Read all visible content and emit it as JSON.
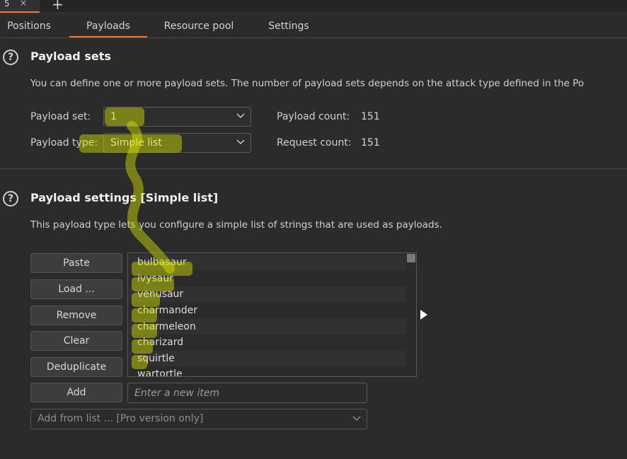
{
  "top": {
    "attack_tab_number": "5",
    "attack_tab_close": "×",
    "add_tab": "+"
  },
  "tabs": [
    {
      "label": "Positions",
      "active": false
    },
    {
      "label": "Payloads",
      "active": true
    },
    {
      "label": "Resource pool",
      "active": false
    },
    {
      "label": "Settings",
      "active": false
    }
  ],
  "payload_sets": {
    "help": "?",
    "title": "Payload sets",
    "description": "You can define one or more payload sets. The number of payload sets depends on the attack type defined in the Po",
    "set_label": "Payload set:",
    "set_value": "1",
    "type_label": "Payload type:",
    "type_value": "Simple list",
    "payload_count_label": "Payload count:",
    "payload_count_value": "151",
    "request_count_label": "Request count:",
    "request_count_value": "151"
  },
  "payload_settings": {
    "help": "?",
    "title": "Payload settings [Simple list]",
    "description": "This payload type lets you configure a simple list of strings that are used as payloads.",
    "buttons": [
      "Paste",
      "Load ...",
      "Remove",
      "Clear",
      "Deduplicate"
    ],
    "add_button": "Add",
    "new_item_placeholder": "Enter a new item",
    "add_from_list": "Add from list ... [Pro version only]",
    "items": [
      "bulbasaur",
      "ivysaur",
      "venusaur",
      "charmander",
      "charmeleon",
      "charizard",
      "squirtle",
      "wartortle"
    ]
  },
  "colors": {
    "accent": "#e8763a",
    "highlighter": "#d9e600"
  },
  "icons": {
    "help": "question-circle-icon",
    "chevron": "chevron-down-icon",
    "close": "close-icon",
    "add": "plus-icon",
    "pointer": "mouse-pointer-icon"
  }
}
